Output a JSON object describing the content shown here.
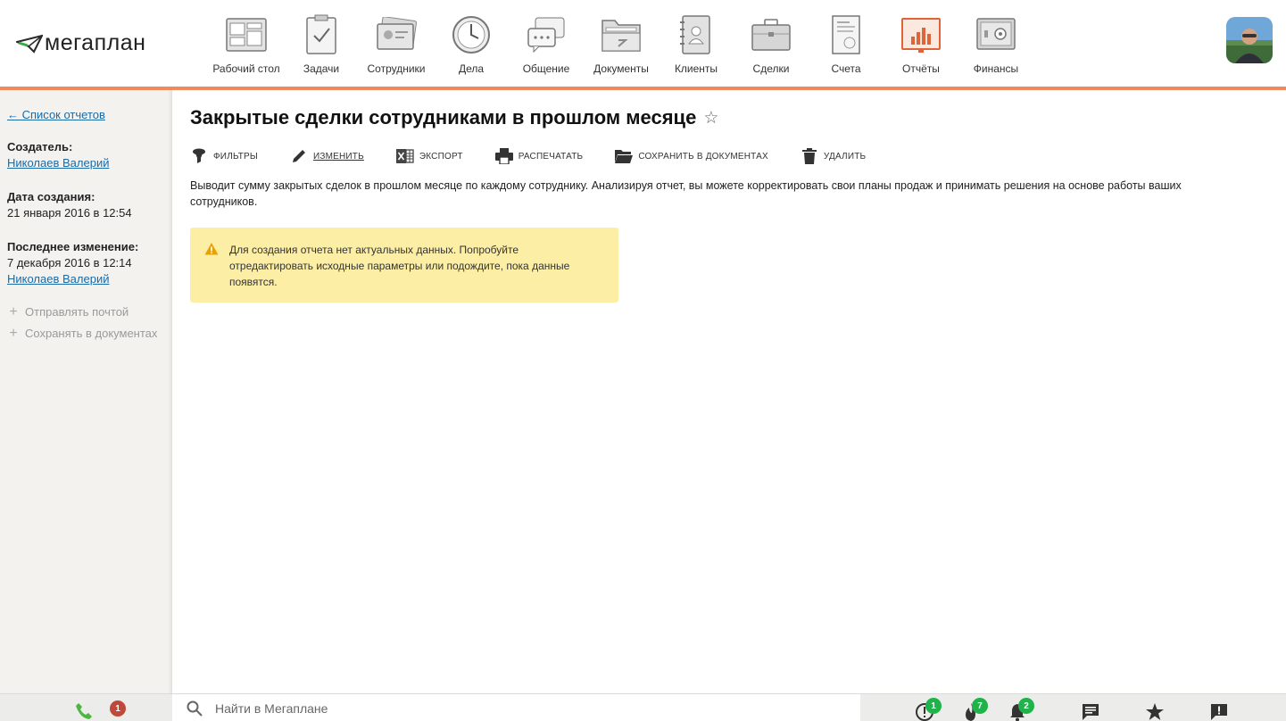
{
  "app": {
    "logo_text": "мегаплан"
  },
  "nav": [
    {
      "label": "Рабочий стол",
      "icon": "desktop-icon",
      "active": false
    },
    {
      "label": "Задачи",
      "icon": "tasks-icon",
      "active": false
    },
    {
      "label": "Сотрудники",
      "icon": "employees-icon",
      "active": false
    },
    {
      "label": "Дела",
      "icon": "clock-icon",
      "active": false
    },
    {
      "label": "Общение",
      "icon": "chat-icon",
      "active": false
    },
    {
      "label": "Документы",
      "icon": "folder-icon",
      "active": false
    },
    {
      "label": "Клиенты",
      "icon": "clients-icon",
      "active": false
    },
    {
      "label": "Сделки",
      "icon": "briefcase-icon",
      "active": false
    },
    {
      "label": "Счета",
      "icon": "invoice-icon",
      "active": false
    },
    {
      "label": "Отчёты",
      "icon": "reports-icon",
      "active": true
    },
    {
      "label": "Финансы",
      "icon": "safe-icon",
      "active": false
    }
  ],
  "sidebar": {
    "back_link": "← Список отчетов",
    "creator_label": "Создатель:",
    "creator_name": "Николаев Валерий",
    "created_label": "Дата создания:",
    "created_date": "21 января 2016 в 12:54",
    "modified_label": "Последнее изменение:",
    "modified_date": "7 декабря 2016 в 12:14",
    "modified_by": "Николаев Валерий",
    "actions": [
      "Отправлять почтой",
      "Сохранять в документах"
    ]
  },
  "main": {
    "title": "Закрытые сделки сотрудниками в прошлом месяце",
    "star_glyph": "☆",
    "toolbar": {
      "filters": "Фильтры",
      "edit": "Изменить",
      "export": "Экспорт",
      "print": "Распечатать",
      "save_docs": "Сохранить в документах",
      "delete": "Удалить"
    },
    "description": "Выводит сумму закрытых сделок в прошлом месяце по каждому сотруднику. Анализируя отчет, вы можете корректировать свои планы продаж и принимать решения на основе работы ваших сотрудников.",
    "alert": "Для создания отчета нет актуальных данных. Попробуйте отредактировать исходные параметры или подождите, пока данные появятся."
  },
  "bottombar": {
    "calls_badge": "1",
    "search_placeholder": "Найти в Мегаплане",
    "notifications": [
      {
        "icon": "alert-circle-icon",
        "count": "1"
      },
      {
        "icon": "fire-icon",
        "count": "7"
      },
      {
        "icon": "bell-icon",
        "count": "2"
      }
    ]
  },
  "colors": {
    "accent": "#f08a5d",
    "link": "#1a6aa7",
    "alert_bg": "#fdeea6",
    "badge_green": "#1fb34a",
    "badge_red": "#c0483a"
  }
}
